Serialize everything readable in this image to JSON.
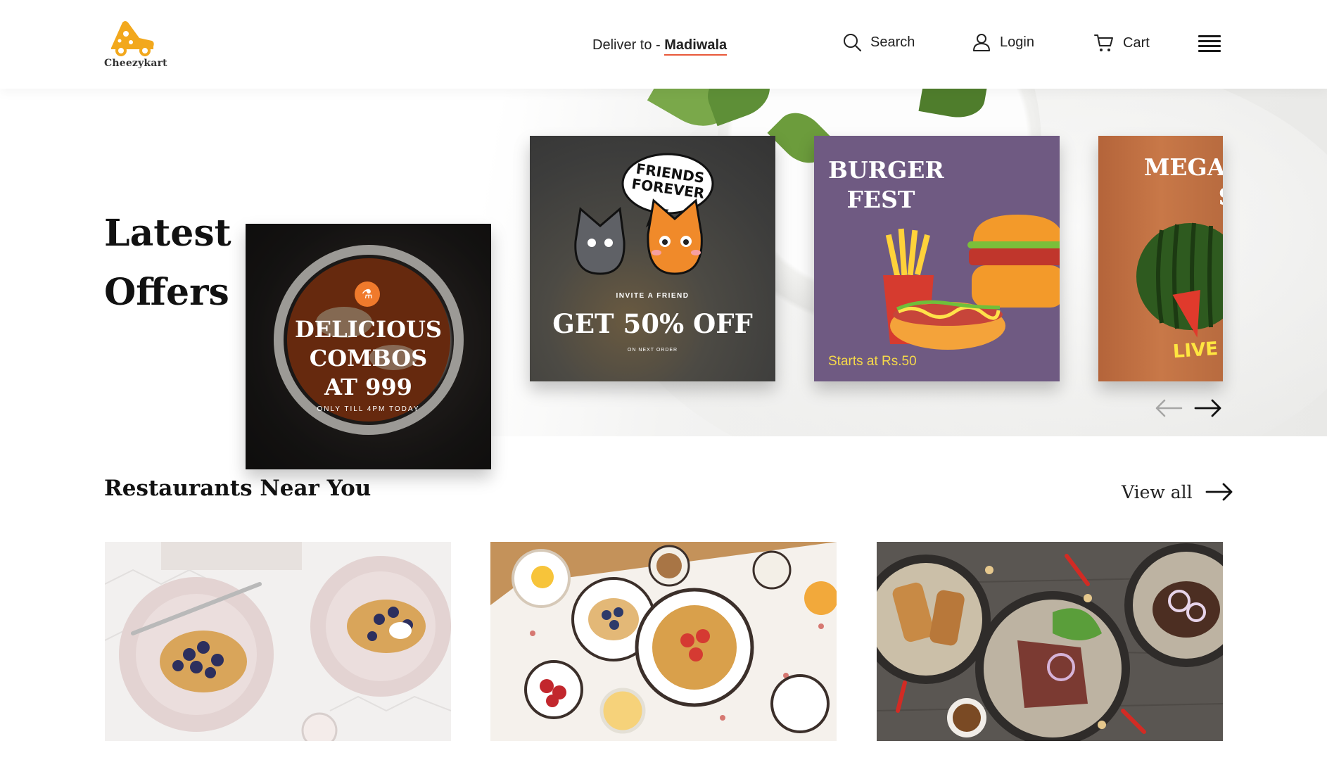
{
  "brand": {
    "name": "Cheezykart",
    "accent": "#f2a81d"
  },
  "header": {
    "deliver_prefix": "Deliver to - ",
    "deliver_location": "Madiwala",
    "nav": {
      "search_label": "Search",
      "login_label": "Login",
      "cart_label": "Cart"
    },
    "icons": [
      "search-icon",
      "user-icon",
      "cart-icon",
      "menu-icon"
    ]
  },
  "offers": {
    "title_line1": "Latest",
    "title_line2": "Offers",
    "cards": [
      {
        "heading_lines": [
          "DELICIOUS",
          "COMBOS",
          "AT 999"
        ],
        "subtext": "ONLY TILL 4PM TODAY",
        "badge_icon": "cutlery-icon"
      },
      {
        "bubble": "FRIENDS FOREVER",
        "invite": "INVITE A FRIEND",
        "heading": "GET 50% OFF",
        "subtext": "ON NEXT ORDER"
      },
      {
        "heading_lines": [
          "BURGER",
          "FEST"
        ],
        "price": "Starts at Rs.50"
      },
      {
        "heading_lines": [
          "MEGA G",
          "SA"
        ],
        "badge": "LIVE"
      }
    ],
    "nav_icons": [
      "arrow-left-icon",
      "arrow-right-icon"
    ]
  },
  "restaurants": {
    "title": "Restaurants Near You",
    "view_all_label": "View all"
  }
}
